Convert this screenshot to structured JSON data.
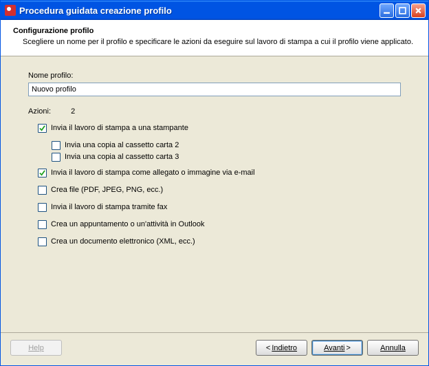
{
  "titlebar": {
    "title": "Procedura guidata creazione profilo"
  },
  "header": {
    "heading": "Configurazione profilo",
    "subheading": "Scegliere un nome per il profilo e specificare le azioni da eseguire sul lavoro di stampa a cui il profilo viene applicato."
  },
  "profile": {
    "label": "Nome profilo:",
    "value": "Nuovo profilo"
  },
  "actions": {
    "label": "Azioni:",
    "count": "2",
    "items": [
      {
        "label": "Invia il lavoro di stampa a una stampante",
        "checked": true,
        "sub": false
      },
      {
        "label": "Invia una copia al cassetto carta 2",
        "checked": false,
        "sub": true
      },
      {
        "label": "Invia una copia al cassetto carta 3",
        "checked": false,
        "sub": true
      },
      {
        "label": "Invia il lavoro di stampa come allegato o immagine via e-mail",
        "checked": true,
        "sub": false
      },
      {
        "label": "Crea file (PDF, JPEG, PNG, ecc.)",
        "checked": false,
        "sub": false
      },
      {
        "label": "Invia il lavoro di stampa tramite fax",
        "checked": false,
        "sub": false
      },
      {
        "label": "Crea un appuntamento o un'attività in Outlook",
        "checked": false,
        "sub": false
      },
      {
        "label": "Crea un documento elettronico (XML, ecc.)",
        "checked": false,
        "sub": false
      }
    ]
  },
  "footer": {
    "help": "Help",
    "back_prefix": "< ",
    "back": "Indietro",
    "next": "Avanti",
    "next_suffix": " >",
    "cancel": "Annulla"
  }
}
